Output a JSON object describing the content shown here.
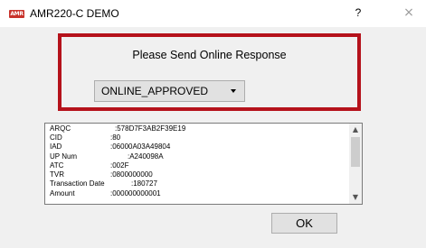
{
  "window": {
    "title": "AMR220-C DEMO",
    "app_icon_text": "AMR",
    "help_label": "?",
    "close_label": "×"
  },
  "prompt": {
    "text": "Please Send Online Response",
    "select_value": "ONLINE_APPROVED"
  },
  "details": {
    "fields": [
      {
        "label": "ARQC",
        "value": ":578D7F3AB2F39E19"
      },
      {
        "label": "CID",
        "value": ":80"
      },
      {
        "label": "IAD",
        "value": ":06000A03A49804"
      },
      {
        "label": "UP Num",
        "value": ":A240098A"
      },
      {
        "label": "ATC",
        "value": ":002F"
      },
      {
        "label": "TVR",
        "value": ":0800000000"
      },
      {
        "label": "Transaction Date",
        "value": ":180727"
      },
      {
        "label": "Amount",
        "value": ":000000000001"
      }
    ],
    "scroll_up": "▲",
    "scroll_down": "▼"
  },
  "buttons": {
    "ok_label": "OK"
  },
  "colors": {
    "highlight_border": "#b5121b",
    "panel_bg": "#f0f0f0"
  }
}
